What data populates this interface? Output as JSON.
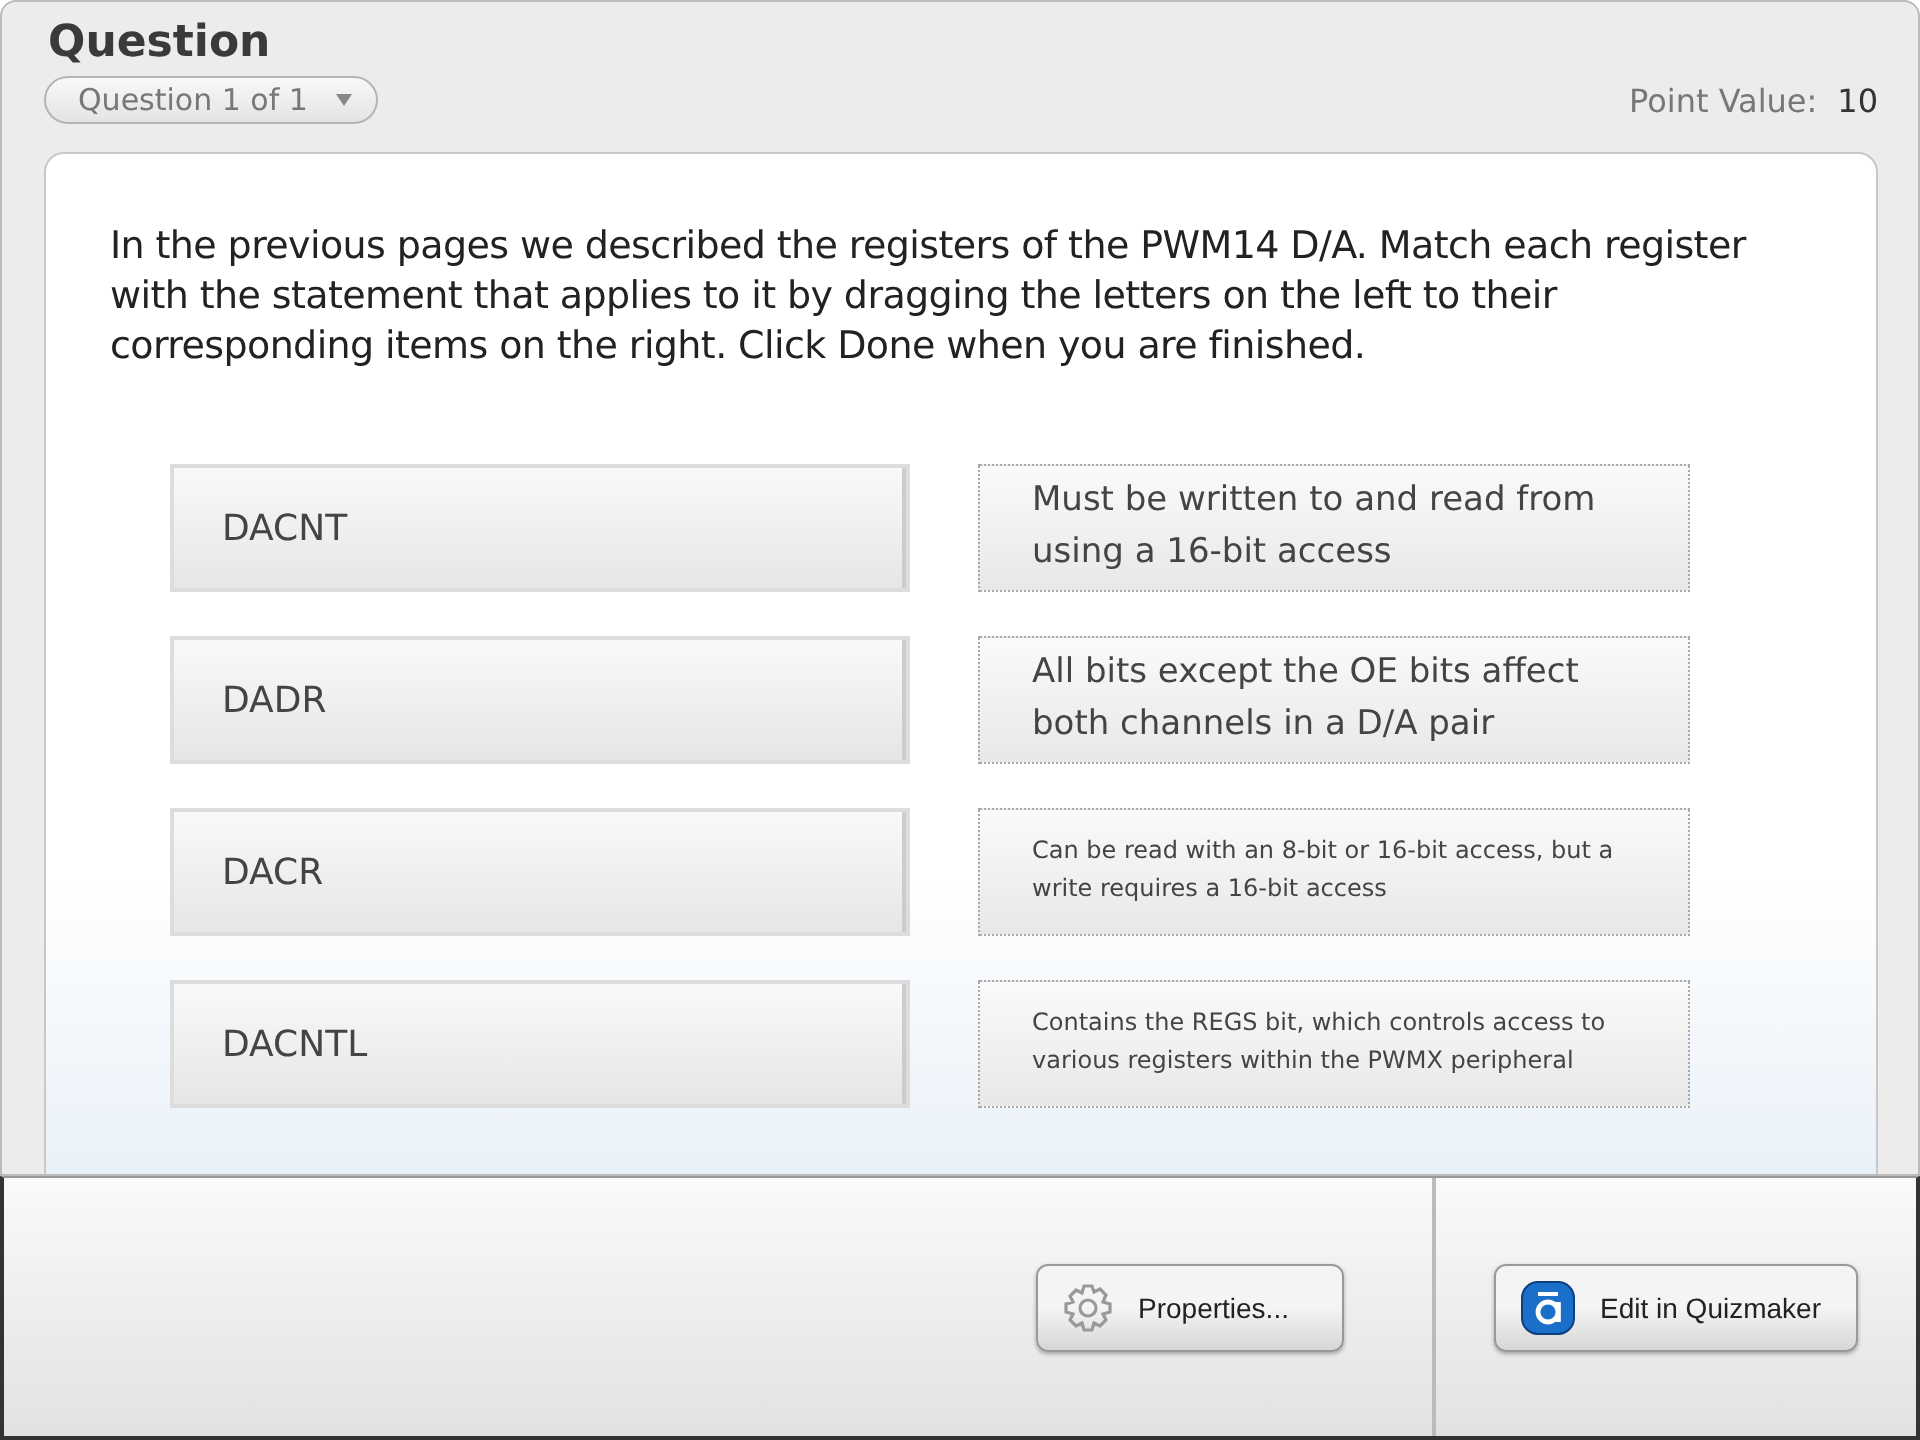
{
  "header": {
    "title": "Question",
    "question_selector": "Question 1 of 1",
    "point_value_label": "Point Value:",
    "point_value": "10"
  },
  "prompt": "In the previous pages we described the registers of the PWM14 D/A. Match each register with the statement that applies to it by dragging the letters on the left to their corresponding items on the right. Click Done when you are finished.",
  "pairs": [
    {
      "term": "DACNT",
      "statement": "Must be written to and read from using a 16-bit access",
      "kind": "large"
    },
    {
      "term": "DADR",
      "statement": "All bits except the OE bits affect both channels in a D/A pair",
      "kind": "large"
    },
    {
      "term": "DACR",
      "statement": "Can be read with an 8-bit or 16-bit access, but a write requires a 16-bit access",
      "kind": "small"
    },
    {
      "term": "DACNTL",
      "statement": "Contains the REGS bit, which controls access to various registers within the PWMX peripheral",
      "kind": "small"
    }
  ],
  "buttons": [
    {
      "label": "Properties..."
    },
    {
      "label": "Edit in Quizmaker"
    }
  ]
}
